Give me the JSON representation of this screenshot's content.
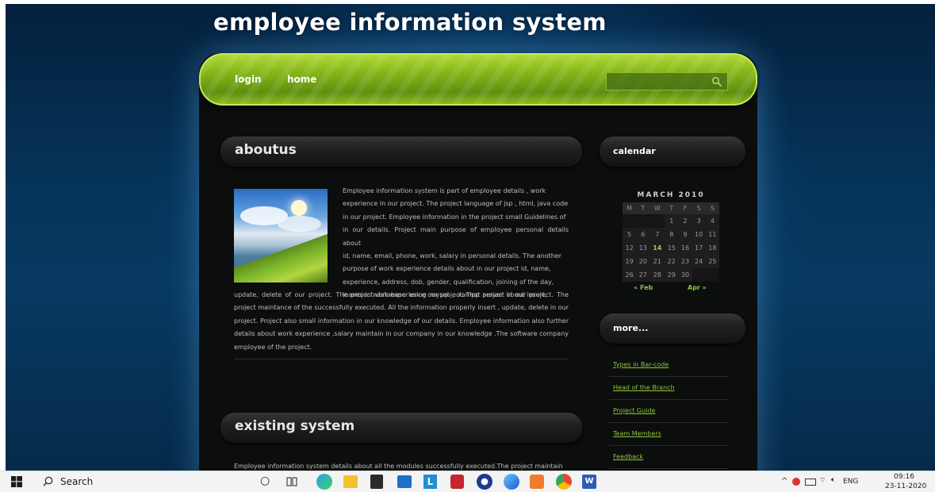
{
  "site": {
    "title": "employee information system"
  },
  "nav": {
    "links": [
      "login",
      "home"
    ],
    "search_placeholder": ""
  },
  "aboutus": {
    "heading": "aboutus",
    "paragraph_lines": [
      "Employee information system is part of employee details , work",
      "experience in our project. The project language of jsp , html, java code",
      "in our project. Employee information in the project small Guidelines of",
      "in our details. Project main purpose of employee personal details about",
      "id, name, email, phone, work, salary in personal details. The another",
      "purpose of work experience details about in our project id, name,",
      "experience, address, dob, gender, qualification, joining of the day,",
      "leaves in work experience our project. That project about insert,"
    ],
    "paragraph_rest": "update, delete of our project. The project database using mysql , xampp server in our project. The project maintance of the successfully executed. All the information properly insert , update, delete in our project. Project also small information in our knowledge of our details. Employee information also further details about work experience ,salary maintain in our company in our knowledge .The software company employee of the project."
  },
  "existing": {
    "heading": "existing system",
    "paragraph": "Employee information system details about all the modules successfully executed.The project maintain"
  },
  "sidebar": {
    "calendar_heading": "calendar",
    "calendar": {
      "title": "MARCH 2010",
      "weekdays": [
        "M",
        "T",
        "W",
        "T",
        "F",
        "S",
        "S"
      ],
      "weeks": [
        [
          "",
          "",
          "",
          "1",
          "2",
          "3",
          "4"
        ],
        [
          "5",
          "6",
          "7",
          "8",
          "9",
          "10",
          "11"
        ],
        [
          "12",
          "13",
          "14",
          "15",
          "16",
          "17",
          "18"
        ],
        [
          "19",
          "20",
          "21",
          "22",
          "23",
          "24",
          "25"
        ],
        [
          "26",
          "27",
          "28",
          "29",
          "30",
          "",
          ""
        ]
      ],
      "today": "14",
      "prev": "« Feb",
      "next": "Apr »"
    },
    "more_heading": "more...",
    "more_links": [
      "Types in Bar-code",
      "Head of the Branch",
      "Project Guide",
      "Team Members",
      "Feedback"
    ]
  },
  "taskbar": {
    "search_label": "Search",
    "language": "ENG",
    "time": "09:16",
    "date": "23-11-2020"
  },
  "colors": {
    "accent_green": "#8cc63f",
    "nav_green": "#86b81a",
    "page_bg": "#0c0d0d",
    "backdrop_blue": "#06345a"
  }
}
